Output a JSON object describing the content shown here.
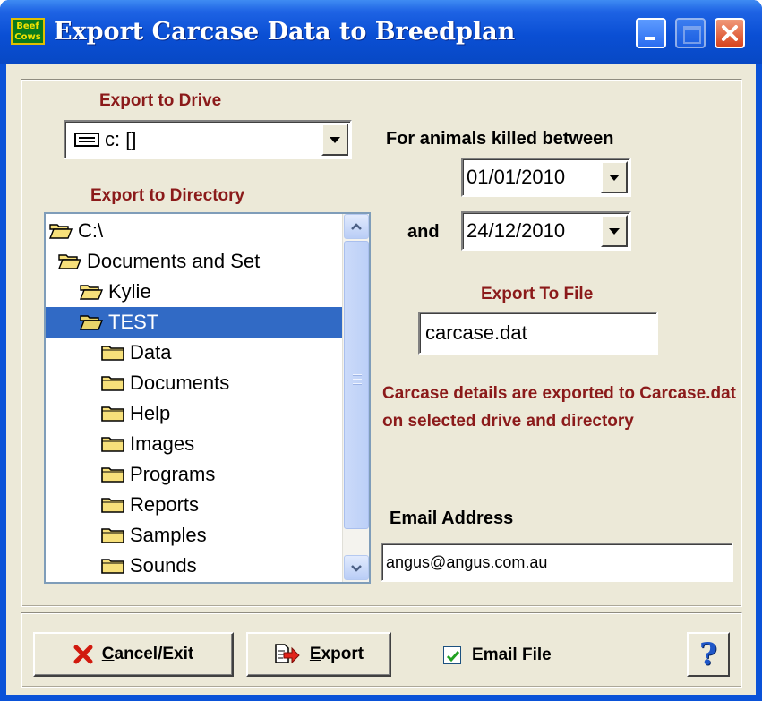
{
  "window": {
    "title": "Export Carcase Data to Breedplan",
    "app_icon_text": "Beef Cows"
  },
  "drive": {
    "label": "Export to Drive",
    "value": "c: []"
  },
  "directory": {
    "label": "Export to Directory",
    "items": [
      {
        "name": "C:\\",
        "icon": "open-folder-icon",
        "selected": false
      },
      {
        "name": "Documents and Set",
        "icon": "open-folder-icon",
        "selected": false
      },
      {
        "name": "Kylie",
        "icon": "open-folder-icon",
        "selected": false
      },
      {
        "name": "TEST",
        "icon": "open-folder-icon",
        "selected": true
      },
      {
        "name": "Data",
        "icon": "folder-icon",
        "selected": false
      },
      {
        "name": "Documents",
        "icon": "folder-icon",
        "selected": false
      },
      {
        "name": "Help",
        "icon": "folder-icon",
        "selected": false
      },
      {
        "name": "Images",
        "icon": "folder-icon",
        "selected": false
      },
      {
        "name": "Programs",
        "icon": "folder-icon",
        "selected": false
      },
      {
        "name": "Reports",
        "icon": "folder-icon",
        "selected": false
      },
      {
        "name": "Samples",
        "icon": "folder-icon",
        "selected": false
      },
      {
        "name": "Sounds",
        "icon": "folder-icon",
        "selected": false
      }
    ]
  },
  "date_range": {
    "label": "For animals killed between",
    "from": "01/01/2010",
    "and_label": "and",
    "to": "24/12/2010"
  },
  "export_file": {
    "label": "Export To File",
    "value": "carcase.dat"
  },
  "notice": "Carcase details are exported to Carcase.dat on selected drive and directory",
  "email": {
    "label": "Email Address",
    "value": "angus@angus.com.au"
  },
  "buttons": {
    "cancel_label": "Cancel/Exit",
    "cancel_hotkey": "C",
    "cancel_rest": "ancel/Exit",
    "export_label": "Export",
    "export_hotkey": "E",
    "export_rest": "xport",
    "email_file_label": "Email File",
    "email_file_hotkey": "E",
    "email_file_rest": "mail File",
    "email_file_checked": true,
    "help_label": "?"
  },
  "colors": {
    "accent_maroon": "#8b1a1a",
    "selection": "#316ac5",
    "titlebar": "#0a4fd4",
    "face": "#ece9d8"
  }
}
